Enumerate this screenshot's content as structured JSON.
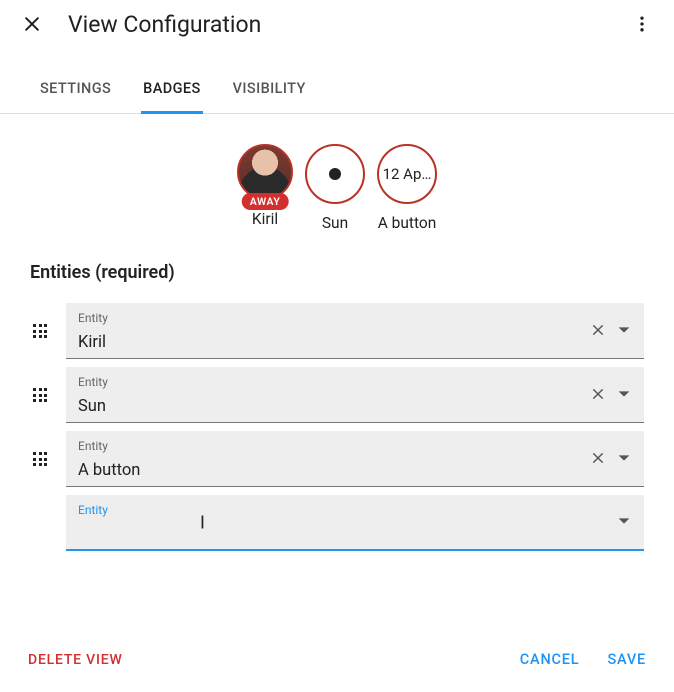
{
  "header": {
    "title": "View Configuration"
  },
  "tabs": [
    {
      "id": "settings",
      "label": "SETTINGS",
      "active": false
    },
    {
      "id": "badges",
      "label": "BADGES",
      "active": true
    },
    {
      "id": "visibility",
      "label": "VISIBILITY",
      "active": false
    }
  ],
  "badges_preview": [
    {
      "label": "Kiril",
      "status": "AWAY",
      "kind": "avatar"
    },
    {
      "label": "Sun",
      "kind": "sun"
    },
    {
      "label": "A button",
      "kind": "text",
      "text": "12 Ap…"
    }
  ],
  "entities": {
    "heading": "Entities (required)",
    "field_label": "Entity",
    "items": [
      {
        "value": "Kiril"
      },
      {
        "value": "Sun"
      },
      {
        "value": "A button"
      }
    ],
    "empty_field_focused": true
  },
  "actions": {
    "delete": "DELETE VIEW",
    "cancel": "CANCEL",
    "save": "SAVE"
  }
}
